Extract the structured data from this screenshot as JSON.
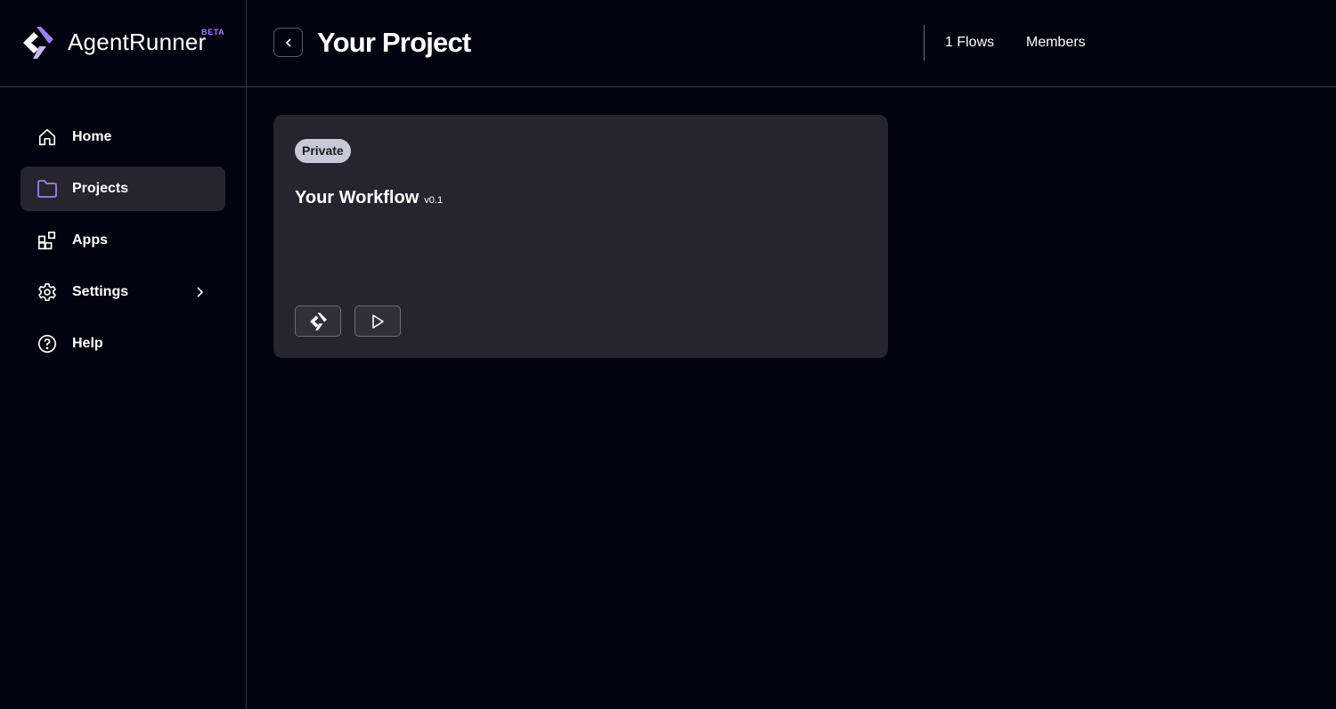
{
  "brand": {
    "name": "AgentRunner",
    "badge": "BETA",
    "accent": "#a07ff0",
    "accent_light": "#c9b5f7",
    "logo_icon": "agentrunner-logo-icon"
  },
  "sidebar": {
    "items": [
      {
        "label": "Home",
        "icon": "home-icon",
        "active": false
      },
      {
        "label": "Projects",
        "icon": "folder-icon",
        "active": true
      },
      {
        "label": "Apps",
        "icon": "apps-grid-icon",
        "active": false
      },
      {
        "label": "Settings",
        "icon": "gear-icon",
        "active": false,
        "has_submenu": true
      },
      {
        "label": "Help",
        "icon": "help-circle-icon",
        "active": false
      }
    ]
  },
  "header": {
    "title": "Your Project",
    "back_icon": "chevron-left-icon",
    "flows_label": "1 Flows",
    "members_label": "Members"
  },
  "workflow_card": {
    "visibility_badge": "Private",
    "title": "Your Workflow",
    "version": "v0.1",
    "editor_icon": "flow-editor-icon",
    "run_icon": "play-icon"
  },
  "colors": {
    "background": "#03020f",
    "surface": "#25242f",
    "border": "#3a3946",
    "badge_bg": "#c9c8d6"
  }
}
